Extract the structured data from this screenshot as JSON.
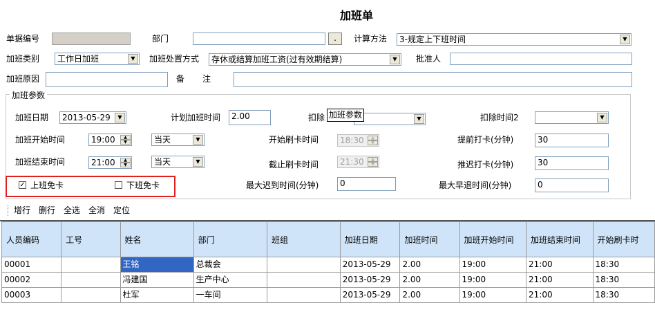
{
  "title": "加班单",
  "header": {
    "doc_no_label": "单据编号",
    "doc_no_value": "",
    "dept_label": "部门",
    "dept_value": "",
    "dept_btn": ".",
    "calc_label": "计算方法",
    "calc_value": "3-规定上下班时间",
    "ot_type_label": "加班类别",
    "ot_type_value": "工作日加班",
    "ot_handle_label": "加班处置方式",
    "ot_handle_value": "存休或结算加班工资(过有效期结算)",
    "approver_label": "批准人",
    "approver_value": "",
    "reason_label": "加班原因",
    "reason_value": "",
    "remark_label1": "备",
    "remark_label2": "注",
    "remark_value": ""
  },
  "params": {
    "group_title": "加班参数",
    "date_label": "加班日期",
    "date_value": "2013-05-29",
    "plan_label": "计划加班时间",
    "plan_value": "2.00",
    "deduct1_label": "扣除",
    "tooltip": "加班参数",
    "deduct2_label": "扣除时间2",
    "deduct2_value": "",
    "start_label": "加班开始时间",
    "start_value": "19:00",
    "start_day": "当天",
    "card_start_label": "开始刷卡时间",
    "card_start_value": "18:30",
    "early_label": "提前打卡(分钟)",
    "early_value": "30",
    "end_label": "加班结束时间",
    "end_value": "21:00",
    "end_day": "当天",
    "card_end_label": "截止刷卡时间",
    "card_end_value": "21:30",
    "late_card_label": "推迟打卡(分钟)",
    "late_card_value": "30",
    "on_free_label": "上班免卡",
    "on_free_checked": "✓",
    "off_free_label": "下班免卡",
    "max_late_label": "最大迟到时间(分钟)",
    "max_late_value": "0",
    "max_early_label": "最大早退时间(分钟)",
    "max_early_value": "0"
  },
  "toolbar": {
    "add": "增行",
    "del": "删行",
    "select_all": "全选",
    "deselect_all": "全消",
    "locate": "定位"
  },
  "table": {
    "headers": [
      "人员编码",
      "工号",
      "姓名",
      "部门",
      "班组",
      "加班日期",
      "加班时间",
      "加班开始时间",
      "加班结束时间",
      "开始刷卡时"
    ],
    "rows": [
      [
        "00001",
        "",
        "王铭",
        "总裁会",
        "",
        "2013-05-29",
        "2.00",
        "19:00",
        "21:00",
        "18:30"
      ],
      [
        "00002",
        "",
        "冯建国",
        "生产中心",
        "",
        "2013-05-29",
        "2.00",
        "19:00",
        "21:00",
        "18:30"
      ],
      [
        "00003",
        "",
        "杜军",
        "一车间",
        "",
        "2013-05-29",
        "2.00",
        "19:00",
        "21:00",
        "18:30"
      ]
    ]
  }
}
